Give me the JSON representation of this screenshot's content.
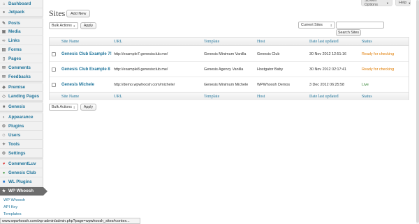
{
  "sidebar": {
    "items": [
      {
        "label": "Dashboard",
        "icon": "dashboard-icon",
        "glyph": "⌂"
      },
      {
        "label": "Jetpack",
        "icon": "jetpack-icon",
        "glyph": "●"
      },
      {
        "label": "Posts",
        "icon": "pin-icon",
        "glyph": "✎"
      },
      {
        "label": "Media",
        "icon": "media-icon",
        "glyph": "▣"
      },
      {
        "label": "Links",
        "icon": "link-icon",
        "glyph": "∞"
      },
      {
        "label": "Forms",
        "icon": "forms-icon",
        "glyph": "▤"
      },
      {
        "label": "Pages",
        "icon": "page-icon",
        "glyph": "▯"
      },
      {
        "label": "Comments",
        "icon": "comment-icon",
        "glyph": "✉"
      },
      {
        "label": "Feedbacks",
        "icon": "feedback-icon",
        "glyph": "✉"
      },
      {
        "label": "Premise",
        "icon": "premise-icon",
        "glyph": "◆"
      },
      {
        "label": "Landing Pages",
        "icon": "landing-pages-icon",
        "glyph": "◇"
      },
      {
        "label": "Genesis",
        "icon": "genesis-icon",
        "glyph": "■"
      },
      {
        "label": "Appearance",
        "icon": "appearance-icon",
        "glyph": "◐"
      },
      {
        "label": "Plugins",
        "icon": "plugin-icon",
        "glyph": "⚙"
      },
      {
        "label": "Users",
        "icon": "users-icon",
        "glyph": "☺"
      },
      {
        "label": "Tools",
        "icon": "tools-icon",
        "glyph": "✦"
      },
      {
        "label": "Settings",
        "icon": "settings-icon",
        "glyph": "⚙"
      },
      {
        "label": "CommentLuv",
        "icon": "commentluv-icon",
        "glyph": "♥"
      },
      {
        "label": "Genesis Club",
        "icon": "genesis-club-icon",
        "glyph": "●"
      },
      {
        "label": "WL Plugins",
        "icon": "wl-plugins-icon",
        "glyph": "■"
      },
      {
        "label": "WP Whoosh",
        "icon": "wp-whoosh-icon",
        "glyph": "★"
      }
    ],
    "submenu": [
      "WP Whoosh",
      "API Key",
      "Templates"
    ]
  },
  "top": {
    "screen_options": "Screen Options",
    "help": "Help"
  },
  "header": {
    "title": "Sites",
    "add_new": "Add New"
  },
  "bulk": {
    "label": "Bulk Actions",
    "apply": "Apply"
  },
  "filter": {
    "selected": "Current Sites",
    "search_button": "Search Sites",
    "search_value": ""
  },
  "table": {
    "columns": [
      "Site Name",
      "URL",
      "Template",
      "Host",
      "Date last updated",
      "Status"
    ],
    "rows": [
      {
        "name": "Genesis Club Example 7!",
        "url": "http://example7.genesisclub.me/",
        "template": "Genesis Minimum Vanilla",
        "host": "Genesis Club",
        "date": "30 Nov 2012 12:51:16",
        "status": "Ready for checking"
      },
      {
        "name": "Genesis Club Example 8",
        "url": "http://example8.genesisclub.me/",
        "template": "Genesis Agency Vanilla",
        "host": "Hostgator Baby",
        "date": "30 Nov 2012 02:17:41",
        "status": "Ready for checking"
      },
      {
        "name": "Genesis Michele",
        "url": "http://demo.wpwhoosh.com/michele/",
        "template": "Genesis Minimum Michele",
        "host": "WPWhoosh Demos",
        "date": "3 Dec 2012 06:25:58",
        "status": "Live"
      }
    ]
  },
  "statusbar": "www.wpwhoosh.com/wp-admin/admin.php?page=wpwhoosh_sites#contex...",
  "colors": {
    "link": "#21759b",
    "ready": "#e07b00",
    "live": "#2a7d2a",
    "current_menu": "#6d6d6d"
  }
}
